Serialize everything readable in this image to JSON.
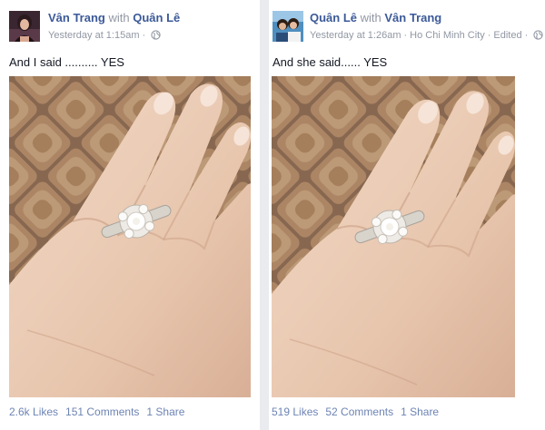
{
  "posts": [
    {
      "author": "Vân Trang",
      "with_text": "with",
      "tagged": "Quân Lê",
      "time": "Yesterday at 1:15am",
      "status": "And I said .......... YES",
      "likes": "2.6k Likes",
      "comments": "151 Comments",
      "shares": "1 Share",
      "audience_icon": "globe-icon"
    },
    {
      "author": "Quân Lê",
      "with_text": "with",
      "tagged": "Vân Trang",
      "time": "Yesterday at 1:26am",
      "location": "Ho Chi Minh City",
      "edited": "Edited",
      "status": "And she said...... YES",
      "likes": "519 Likes",
      "comments": "52 Comments",
      "shares": "1 Share",
      "audience_icon": "globe-icon"
    }
  ],
  "colors": {
    "link": "#3b5998",
    "meta": "#9197a3",
    "stats": "#6d84b4",
    "divider": "#e9ebee"
  }
}
